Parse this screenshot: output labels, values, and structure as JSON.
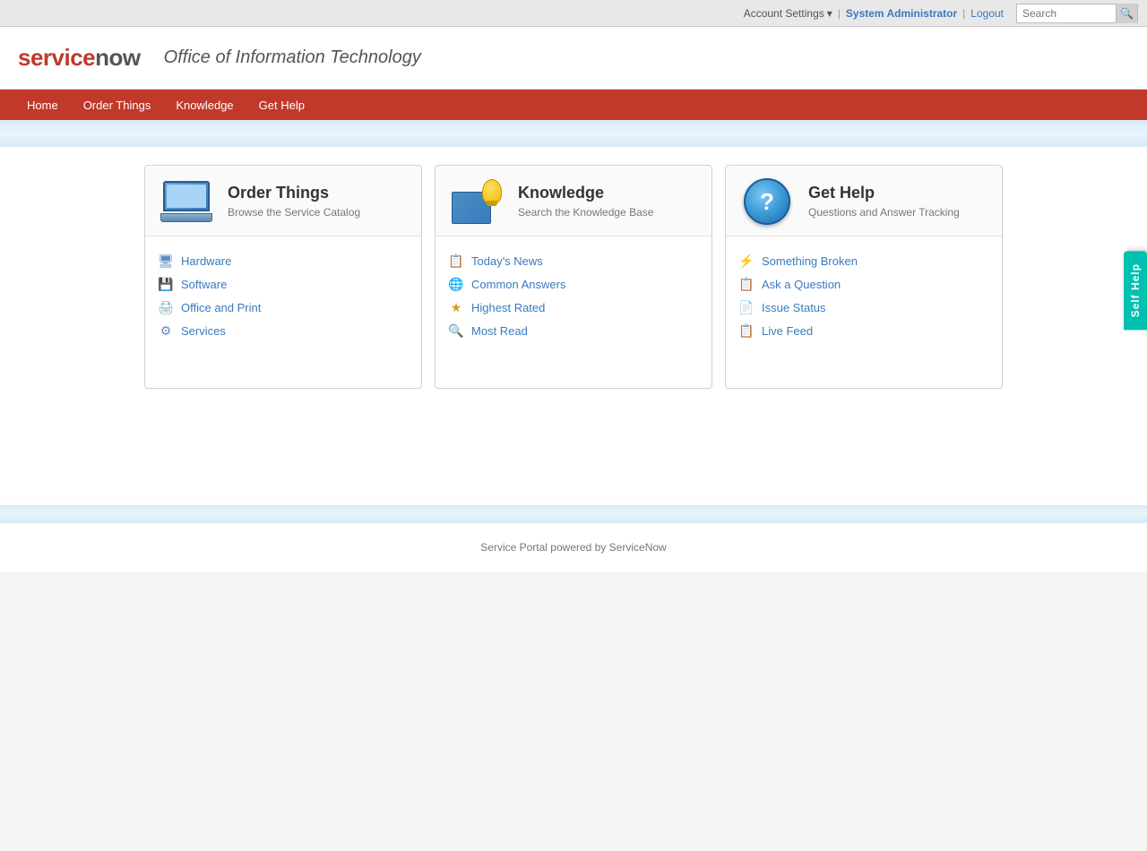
{
  "topbar": {
    "account_settings": "Account Settings",
    "chevron": "▾",
    "separator": "|",
    "sys_admin": "System Administrator",
    "logout": "Logout",
    "search_placeholder": "Search",
    "search_icon": "🔍"
  },
  "header": {
    "logo_service": "service",
    "logo_now": "now",
    "title": "Office of Information Technology"
  },
  "nav": {
    "items": [
      {
        "label": "Home",
        "id": "home"
      },
      {
        "label": "Order Things",
        "id": "order-things"
      },
      {
        "label": "Knowledge",
        "id": "knowledge"
      },
      {
        "label": "Get Help",
        "id": "get-help"
      }
    ]
  },
  "cards": [
    {
      "id": "order-things",
      "title": "Order Things",
      "subtitle": "Browse the Service Catalog",
      "links": [
        {
          "label": "Hardware",
          "icon": "🖥",
          "id": "hardware"
        },
        {
          "label": "Software",
          "icon": "💾",
          "id": "software"
        },
        {
          "label": "Office and Print",
          "icon": "🖨",
          "id": "office-print"
        },
        {
          "label": "Services",
          "icon": "⚙",
          "id": "services"
        }
      ]
    },
    {
      "id": "knowledge",
      "title": "Knowledge",
      "subtitle": "Search the Knowledge Base",
      "links": [
        {
          "label": "Today's News",
          "icon": "📋",
          "id": "todays-news"
        },
        {
          "label": "Common Answers",
          "icon": "🌐",
          "id": "common-answers"
        },
        {
          "label": "Highest Rated",
          "icon": "★",
          "id": "highest-rated"
        },
        {
          "label": "Most Read",
          "icon": "🔍",
          "id": "most-read"
        }
      ]
    },
    {
      "id": "get-help",
      "title": "Get Help",
      "subtitle": "Questions and Answer Tracking",
      "links": [
        {
          "label": "Something Broken",
          "icon": "⚡",
          "id": "something-broken"
        },
        {
          "label": "Ask a Question",
          "icon": "📋",
          "id": "ask-question"
        },
        {
          "label": "Issue Status",
          "icon": "📄",
          "id": "issue-status"
        },
        {
          "label": "Live Feed",
          "icon": "📋",
          "id": "live-feed"
        }
      ]
    }
  ],
  "self_help_tab": "Self Help",
  "footer": "Service Portal powered by ServiceNow"
}
